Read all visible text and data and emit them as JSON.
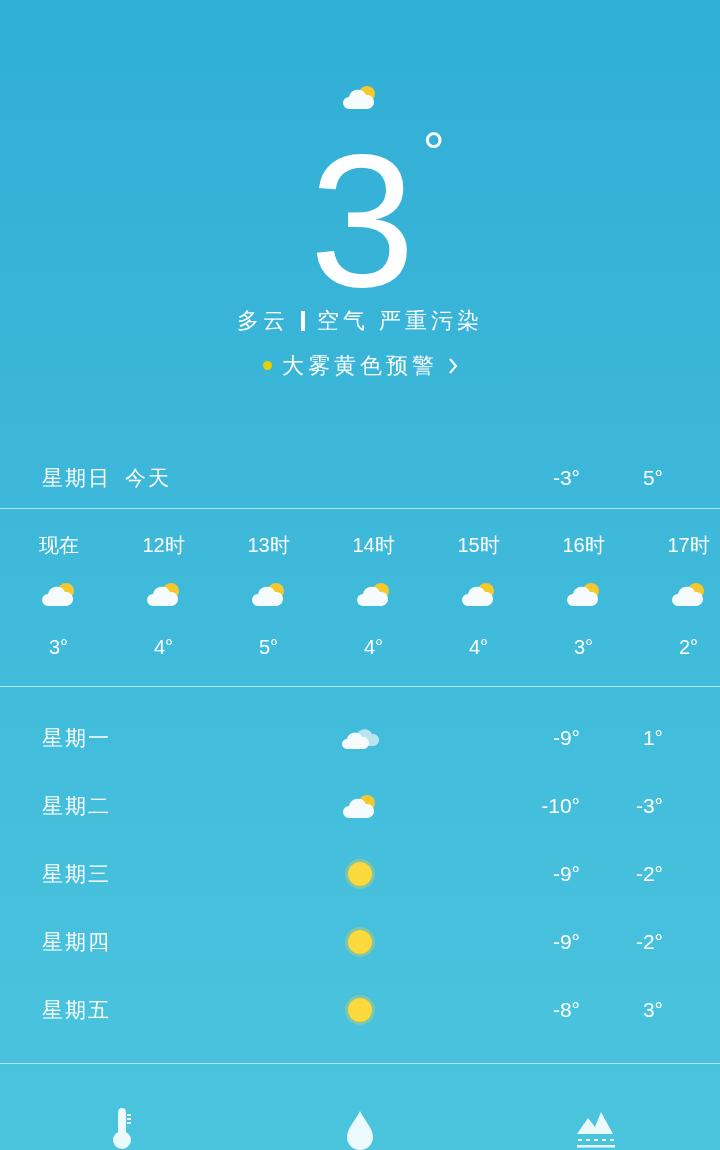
{
  "current": {
    "kind": "partly_cloudy",
    "temperature": "3",
    "degree": "°",
    "condition": "多云",
    "air_quality": "空气 严重污染",
    "alert": {
      "text": "大雾黄色预警",
      "color": "#e6d200"
    }
  },
  "today": {
    "day": "星期日",
    "label": "今天",
    "low": "-3°",
    "high": "5°"
  },
  "hourly": [
    {
      "time": "现在",
      "kind": "partly_cloudy",
      "temp": "3°"
    },
    {
      "time": "12时",
      "kind": "partly_cloudy",
      "temp": "4°"
    },
    {
      "time": "13时",
      "kind": "partly_cloudy",
      "temp": "5°"
    },
    {
      "time": "14时",
      "kind": "partly_cloudy",
      "temp": "4°"
    },
    {
      "time": "15时",
      "kind": "partly_cloudy",
      "temp": "4°"
    },
    {
      "time": "16时",
      "kind": "partly_cloudy",
      "temp": "3°"
    },
    {
      "time": "17时",
      "kind": "partly_cloudy",
      "temp": "2°"
    }
  ],
  "daily": [
    {
      "day": "星期一",
      "kind": "cloudy",
      "low": "-9°",
      "high": "1°"
    },
    {
      "day": "星期二",
      "kind": "partly_cloudy",
      "low": "-10°",
      "high": "-3°"
    },
    {
      "day": "星期三",
      "kind": "sunny",
      "low": "-9°",
      "high": "-2°"
    },
    {
      "day": "星期四",
      "kind": "sunny",
      "low": "-9°",
      "high": "-2°"
    },
    {
      "day": "星期五",
      "kind": "sunny",
      "low": "-8°",
      "high": "3°"
    }
  ],
  "bottom_bar": [
    {
      "kind": "thermometer"
    },
    {
      "kind": "drop"
    },
    {
      "kind": "mountains"
    }
  ]
}
